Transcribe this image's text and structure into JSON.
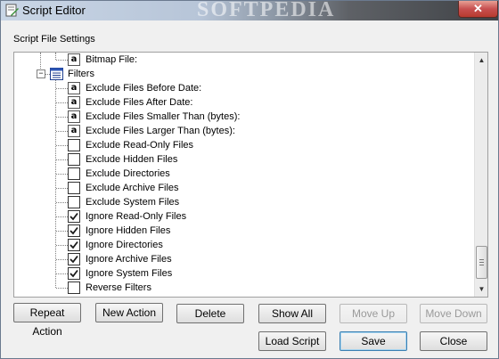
{
  "window": {
    "title": "Script Editor",
    "watermark": "SOFTPEDIA",
    "close_label": "✕"
  },
  "group": {
    "label": "Script File Settings"
  },
  "tree": {
    "rows": [
      {
        "label": "Bitmap File:",
        "type": "text"
      },
      {
        "label": "Filters",
        "type": "group",
        "expanded": true
      },
      {
        "label": "Exclude Files Before Date:",
        "type": "text"
      },
      {
        "label": "Exclude Files After Date:",
        "type": "text"
      },
      {
        "label": "Exclude Files Smaller Than (bytes):",
        "type": "text"
      },
      {
        "label": "Exclude Files Larger Than (bytes):",
        "type": "text"
      },
      {
        "label": "Exclude Read-Only Files",
        "type": "check",
        "checked": false
      },
      {
        "label": "Exclude Hidden Files",
        "type": "check",
        "checked": false
      },
      {
        "label": "Exclude Directories",
        "type": "check",
        "checked": false
      },
      {
        "label": "Exclude Archive Files",
        "type": "check",
        "checked": false
      },
      {
        "label": "Exclude System Files",
        "type": "check",
        "checked": false
      },
      {
        "label": "Ignore Read-Only Files",
        "type": "check",
        "checked": true
      },
      {
        "label": "Ignore Hidden Files",
        "type": "check",
        "checked": true
      },
      {
        "label": "Ignore Directories",
        "type": "check",
        "checked": true
      },
      {
        "label": "Ignore Archive Files",
        "type": "check",
        "checked": true
      },
      {
        "label": "Ignore System Files",
        "type": "check",
        "checked": true
      },
      {
        "label": "Reverse Filters",
        "type": "check",
        "checked": false
      }
    ],
    "text_icon_glyph": "a",
    "expander_glyph": "−",
    "scroll_up_glyph": "▲",
    "scroll_down_glyph": "▼"
  },
  "buttons": {
    "repeat_action": "Repeat Action",
    "new_action": "New Action",
    "delete": "Delete",
    "show_all": "Show All",
    "move_up": "Move Up",
    "move_down": "Move Down",
    "load_script": "Load Script",
    "save": "Save",
    "close": "Close"
  },
  "colors": {
    "window_bg": "#f0f0f0",
    "tree_bg": "#ffffff",
    "checkmark": "#1a1a1a"
  }
}
